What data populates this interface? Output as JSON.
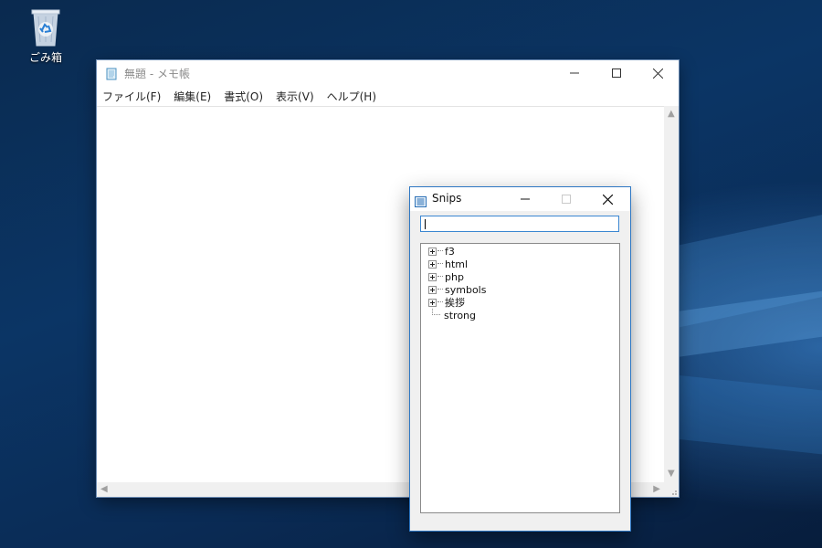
{
  "desktop": {
    "recycle_bin_label": "ごみ箱",
    "recycle_bin_icon": "recycle-bin-icon"
  },
  "notepad": {
    "title": "無題 - メモ帳",
    "app_icon": "notepad-icon",
    "menu": [
      "ファイル(F)",
      "編集(E)",
      "書式(O)",
      "表示(V)",
      "ヘルプ(H)"
    ],
    "content": ""
  },
  "snips": {
    "title": "Snips",
    "app_icon": "list-icon",
    "search_value": "",
    "tree": [
      {
        "label": "f3",
        "expandable": true
      },
      {
        "label": "html",
        "expandable": true
      },
      {
        "label": "php",
        "expandable": true
      },
      {
        "label": "symbols",
        "expandable": true
      },
      {
        "label": "挨拶",
        "expandable": true
      },
      {
        "label": "strong",
        "expandable": false
      }
    ]
  },
  "colors": {
    "desktop_bg": "#0b3565",
    "window_border": "#2f78c4",
    "focus_border": "#3a86d1"
  }
}
